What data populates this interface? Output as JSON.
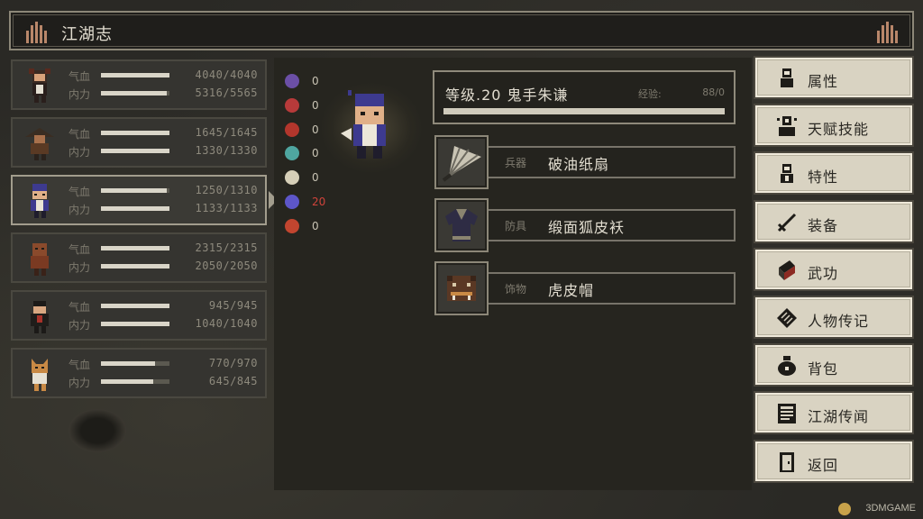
{
  "window": {
    "title": "江湖志"
  },
  "roster": [
    {
      "hp_label": "气血",
      "mp_label": "内力",
      "hp": "4040/4040",
      "mp": "5316/5565",
      "hp_ratio": 1.0,
      "mp_ratio": 0.955,
      "active": false
    },
    {
      "hp_label": "气血",
      "mp_label": "内力",
      "hp": "1645/1645",
      "mp": "1330/1330",
      "hp_ratio": 1.0,
      "mp_ratio": 1.0,
      "active": false
    },
    {
      "hp_label": "气血",
      "mp_label": "内力",
      "hp": "1250/1310",
      "mp": "1133/1133",
      "hp_ratio": 0.954,
      "mp_ratio": 1.0,
      "active": true
    },
    {
      "hp_label": "气血",
      "mp_label": "内力",
      "hp": "2315/2315",
      "mp": "2050/2050",
      "hp_ratio": 1.0,
      "mp_ratio": 1.0,
      "active": false
    },
    {
      "hp_label": "气血",
      "mp_label": "内力",
      "hp": "945/945",
      "mp": "1040/1040",
      "hp_ratio": 1.0,
      "mp_ratio": 1.0,
      "active": false
    },
    {
      "hp_label": "气血",
      "mp_label": "内力",
      "hp": "770/970",
      "mp": "645/845",
      "hp_ratio": 0.794,
      "mp_ratio": 0.763,
      "active": false
    }
  ],
  "resistances": [
    {
      "icon": "skull-icon",
      "value": "0",
      "color": "#6b4fa6",
      "highlight": false
    },
    {
      "icon": "broken-heart-icon",
      "value": "0",
      "color": "#b73a3a",
      "highlight": false
    },
    {
      "icon": "bug-icon",
      "value": "0",
      "color": "#b3362c",
      "highlight": false
    },
    {
      "icon": "poison-skull-icon",
      "value": "0",
      "color": "#4fa6a0",
      "highlight": false
    },
    {
      "icon": "bone-icon",
      "value": "0",
      "color": "#d6cfb8",
      "highlight": false
    },
    {
      "icon": "demon-icon",
      "value": "20",
      "color": "#5d56c9",
      "highlight": true
    },
    {
      "icon": "flame-icon",
      "value": "0",
      "color": "#c2452f",
      "highlight": false
    }
  ],
  "character": {
    "level_text": "等级.20 鬼手朱谦",
    "exp_label": "经验:",
    "exp_value": "88/0",
    "exp_ratio": 1.0
  },
  "equipment": [
    {
      "type": "兵器",
      "name": "破油纸扇",
      "icon": "fan-icon"
    },
    {
      "type": "防具",
      "name": "缎面狐皮袄",
      "icon": "robe-icon"
    },
    {
      "type": "饰物",
      "name": "虎皮帽",
      "icon": "tiger-hat-icon"
    }
  ],
  "menu": [
    {
      "label": "属性",
      "icon": "person-icon"
    },
    {
      "label": "天赋技能",
      "icon": "talent-icon"
    },
    {
      "label": "特性",
      "icon": "trait-icon"
    },
    {
      "label": "装备",
      "icon": "sword-icon"
    },
    {
      "label": "武功",
      "icon": "book-icon"
    },
    {
      "label": "人物传记",
      "icon": "scroll-icon"
    },
    {
      "label": "背包",
      "icon": "bag-icon"
    },
    {
      "label": "江湖传闻",
      "icon": "notice-icon"
    },
    {
      "label": "返回",
      "icon": "door-icon"
    }
  ],
  "watermark": "3DMGAME"
}
